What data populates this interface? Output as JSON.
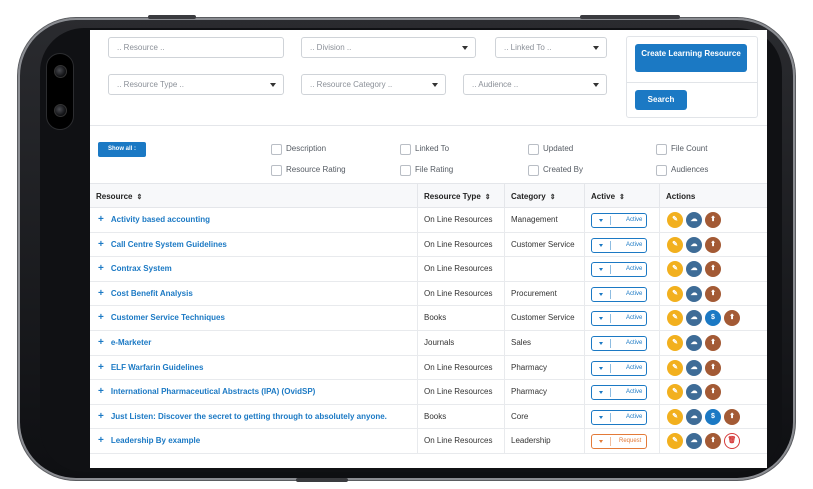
{
  "filters": {
    "resource_placeholder": ".. Resource ..",
    "division_placeholder": ".. Division ..",
    "linked_to_placeholder": ".. Linked To ..",
    "resource_type_placeholder": ".. Resource Type ..",
    "resource_category_placeholder": ".. Resource Category ..",
    "audience_placeholder": ".. Audience .."
  },
  "actions": {
    "create_label": "Create Learning Resource",
    "search_label": "Search",
    "show_all_label": "Show all :"
  },
  "columns_toggle": [
    {
      "label": "Description",
      "checked": false
    },
    {
      "label": "Linked To",
      "checked": false
    },
    {
      "label": "Updated",
      "checked": false
    },
    {
      "label": "File Count",
      "checked": false
    },
    {
      "label": "Resource Rating",
      "checked": false
    },
    {
      "label": "File Rating",
      "checked": false
    },
    {
      "label": "Created By",
      "checked": false
    },
    {
      "label": "Audiences",
      "checked": false
    }
  ],
  "table": {
    "headers": {
      "resource": "Resource",
      "resource_type": "Resource Type",
      "category": "Category",
      "active": "Active",
      "actions": "Actions"
    },
    "rows": [
      {
        "name": "Activity based accounting",
        "type": "On Line Resources",
        "category": "Management",
        "status": "Active",
        "icons": [
          "edit-icon",
          "cloud-icon",
          "user-icon"
        ]
      },
      {
        "name": "Call Centre System Guidelines",
        "type": "On Line Resources",
        "category": "Customer Service",
        "status": "Active",
        "icons": [
          "edit-icon",
          "cloud-icon",
          "user-icon"
        ]
      },
      {
        "name": "Contrax System",
        "type": "On Line Resources",
        "category": "",
        "status": "Active",
        "icons": [
          "edit-icon",
          "cloud-icon",
          "user-icon"
        ]
      },
      {
        "name": "Cost Benefit Analysis",
        "type": "On Line Resources",
        "category": "Procurement",
        "status": "Active",
        "icons": [
          "edit-icon",
          "cloud-icon",
          "user-icon"
        ]
      },
      {
        "name": "Customer Service Techniques",
        "type": "Books",
        "category": "Customer Service",
        "status": "Active",
        "icons": [
          "edit-icon",
          "cloud-icon",
          "dollar-icon",
          "user-icon"
        ]
      },
      {
        "name": "e-Marketer",
        "type": "Journals",
        "category": "Sales",
        "status": "Active",
        "icons": [
          "edit-icon",
          "cloud-icon",
          "user-icon"
        ]
      },
      {
        "name": "ELF Warfarin Guidelines",
        "type": "On Line Resources",
        "category": "Pharmacy",
        "status": "Active",
        "icons": [
          "edit-icon",
          "cloud-icon",
          "user-icon"
        ]
      },
      {
        "name": "International Pharmaceutical Abstracts (IPA) (OvidSP)",
        "type": "On Line Resources",
        "category": "Pharmacy",
        "status": "Active",
        "icons": [
          "edit-icon",
          "cloud-icon",
          "user-icon"
        ]
      },
      {
        "name": "Just Listen: Discover the secret to getting through to absolutely anyone.",
        "type": "Books",
        "category": "Core",
        "status": "Active",
        "icons": [
          "edit-icon",
          "cloud-icon",
          "dollar-icon",
          "user-icon"
        ]
      },
      {
        "name": "Leadership By example",
        "type": "On Line Resources",
        "category": "Leadership",
        "status": "Request",
        "icons": [
          "edit-icon",
          "cloud-icon",
          "user-icon",
          "delete-icon"
        ]
      }
    ]
  },
  "colors": {
    "brand_blue": "#1b79c4",
    "edit_yellow": "#f2b01e",
    "cloud_navy": "#3e6c97",
    "user_brown": "#a35a35",
    "delete_red": "#d63b3b",
    "request_orange": "#e37a38"
  }
}
